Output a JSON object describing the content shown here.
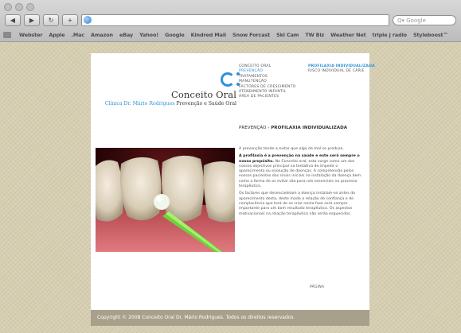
{
  "browser": {
    "search_placeholder": "Google",
    "bookmarks": [
      "Webster",
      "Apple",
      ".Mac",
      "Amazon",
      "eBay",
      "Yahoo!",
      "Google",
      "Kindred Mail",
      "Snow Forcast",
      "Ski Cam",
      "TW Biz",
      "Weather Net",
      "triple j radio",
      "Styleboost™"
    ]
  },
  "site": {
    "logo_title": "Conceito Oral",
    "logo_subtitle_blue": "Clínica Dr. Mário Rodrigues",
    "logo_subtitle_rest": " Prevenção e Saúde Oral",
    "menu": [
      {
        "label": "Conceito Oral",
        "active": false
      },
      {
        "label": "Prevenção",
        "active": true
      },
      {
        "label": "Tratamentos",
        "active": false
      },
      {
        "label": "Manutenção",
        "active": false
      },
      {
        "label": "Factores de Crescimento",
        "active": false
      },
      {
        "label": "Atendimento Infantil",
        "active": false
      },
      {
        "label": "Área de Pacientes",
        "active": false
      }
    ],
    "submenu": [
      {
        "label": "Profilaxia Individualizada",
        "active": true
      },
      {
        "label": "Risco Individual de Cárie",
        "active": false
      }
    ],
    "breadcrumb_parent": "Prevenção",
    "breadcrumb_sep": " › ",
    "breadcrumb_current": "Profilaxia Individualizada",
    "paragraphs": {
      "p1": "A prevenção tende a evitar que algo de mal se produza.",
      "p2_bold": "A profilaxia é a prevenção na saúde e este será sempre o nosso propósito.",
      "p2_rest": " No Conceito oral, esta surge como um dos nossos objectivos principal na tentativa de impedir o aparecimento ou evolução de doenças. A compreensão pelos nossos pacientes dos sinais iniciais na instalação da doença bem como a forma de os evitar são para nós essenciais no processo terapêutico.",
      "p3": "Os factores que desencadeiam a doença instalam-se antes do aparecimento desta, deste modo a relação de confiança e de complacência que terá de se criar nesta fase será sempre importante para um bom resultado terapêutico. Os aspectos motivacionais na relação terapêutica não serão esquecidos."
    },
    "pagination": "Página",
    "footer": "Copyright © 2008 Conceito Oral Dr. Mário Rodrigues. Todos os direitos reservados"
  },
  "colors": {
    "accent": "#2a93d8",
    "footer_bg": "#a7a08b",
    "page_bg": "#d7cfb2"
  }
}
